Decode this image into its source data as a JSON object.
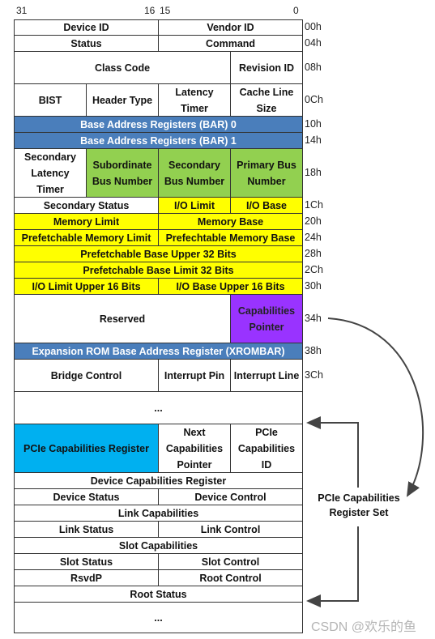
{
  "bit_labels": {
    "b31": "31",
    "b16": "16",
    "b15": "15",
    "b0": "0"
  },
  "colors": {
    "blue": "#4a7ebb",
    "green": "#92d050",
    "yellow": "#ffff00",
    "purple": "#9933ff",
    "cyan": "#00b0f0"
  },
  "rows": [
    {
      "offset": "00h",
      "cells": [
        {
          "text": "Device ID"
        },
        {
          "text": "Vendor ID"
        }
      ]
    },
    {
      "offset": "04h",
      "cells": [
        {
          "text": "Status"
        },
        {
          "text": "Command"
        }
      ]
    },
    {
      "offset": "08h",
      "cells": [
        {
          "text": "Class Code"
        },
        {
          "text": "Revision ID"
        }
      ]
    },
    {
      "offset": "0Ch",
      "cells": [
        {
          "text": "BIST"
        },
        {
          "text": "Header Type"
        },
        {
          "text": "Latency Timer"
        },
        {
          "text": "Cache Line Size"
        }
      ]
    },
    {
      "offset": "10h",
      "cells": [
        {
          "text": "Base Address Registers (BAR) 0",
          "color": "blue"
        }
      ]
    },
    {
      "offset": "14h",
      "cells": [
        {
          "text": "Base Address Registers (BAR) 1",
          "color": "blue"
        }
      ]
    },
    {
      "offset": "18h",
      "cells": [
        {
          "text": "Secondary Latency Timer"
        },
        {
          "text": "Subordinate Bus Number",
          "color": "green"
        },
        {
          "text": "Secondary Bus Number",
          "color": "green"
        },
        {
          "text": "Primary Bus Number",
          "color": "green"
        }
      ]
    },
    {
      "offset": "1Ch",
      "cells": [
        {
          "text": "Secondary Status"
        },
        {
          "text": "I/O Limit",
          "color": "yellow"
        },
        {
          "text": "I/O Base",
          "color": "yellow"
        }
      ]
    },
    {
      "offset": "20h",
      "cells": [
        {
          "text": "Memory Limit",
          "color": "yellow"
        },
        {
          "text": "Memory Base",
          "color": "yellow"
        }
      ]
    },
    {
      "offset": "24h",
      "cells": [
        {
          "text": "Prefetchable Memory Limit",
          "color": "yellow"
        },
        {
          "text": "Prefechtable Memory Base",
          "color": "yellow"
        }
      ]
    },
    {
      "offset": "28h",
      "cells": [
        {
          "text": "Prefetchable Base Upper 32 Bits",
          "color": "yellow"
        }
      ]
    },
    {
      "offset": "2Ch",
      "cells": [
        {
          "text": "Prefetchable Base Limit 32 Bits",
          "color": "yellow"
        }
      ]
    },
    {
      "offset": "30h",
      "cells": [
        {
          "text": "I/O Limit Upper 16 Bits",
          "color": "yellow"
        },
        {
          "text": "I/O Base Upper 16 Bits",
          "color": "yellow"
        }
      ]
    },
    {
      "offset": "34h",
      "cells": [
        {
          "text": "Reserved"
        },
        {
          "text": "Capabilities Pointer",
          "color": "purple"
        }
      ]
    },
    {
      "offset": "38h",
      "cells": [
        {
          "text": "Expansion ROM Base Address Register (XROMBAR)",
          "color": "blue"
        }
      ]
    },
    {
      "offset": "3Ch",
      "cells": [
        {
          "text": "Bridge Control"
        },
        {
          "text": "Interrupt Pin"
        },
        {
          "text": "Interrupt Line"
        }
      ]
    },
    {
      "offset": "",
      "cells": [
        {
          "text": "..."
        }
      ]
    },
    {
      "offset": "",
      "cells": [
        {
          "text": "PCIe Capabilities Register",
          "color": "cyan"
        },
        {
          "text": "Next Capabilities Pointer"
        },
        {
          "text": "PCIe Capabilities ID"
        }
      ]
    },
    {
      "offset": "",
      "cells": [
        {
          "text": "Device Capabilities Register"
        }
      ]
    },
    {
      "offset": "",
      "cells": [
        {
          "text": "Device Status"
        },
        {
          "text": "Device Control"
        }
      ]
    },
    {
      "offset": "",
      "cells": [
        {
          "text": "Link Capabilities"
        }
      ]
    },
    {
      "offset": "",
      "cells": [
        {
          "text": "Link Status"
        },
        {
          "text": "Link Control"
        }
      ]
    },
    {
      "offset": "",
      "cells": [
        {
          "text": "Slot Capabilities"
        }
      ]
    },
    {
      "offset": "",
      "cells": [
        {
          "text": "Slot Status"
        },
        {
          "text": "Slot Control"
        }
      ]
    },
    {
      "offset": "",
      "cells": [
        {
          "text": "RsvdP"
        },
        {
          "text": "Root Control"
        }
      ]
    },
    {
      "offset": "",
      "cells": [
        {
          "text": "Root Status"
        }
      ]
    },
    {
      "offset": "",
      "cells": [
        {
          "text": "..."
        }
      ]
    }
  ],
  "capabilities_set_label": "PCIe Capabilities Register Set",
  "watermark": "CSDN @欢乐的鱼"
}
